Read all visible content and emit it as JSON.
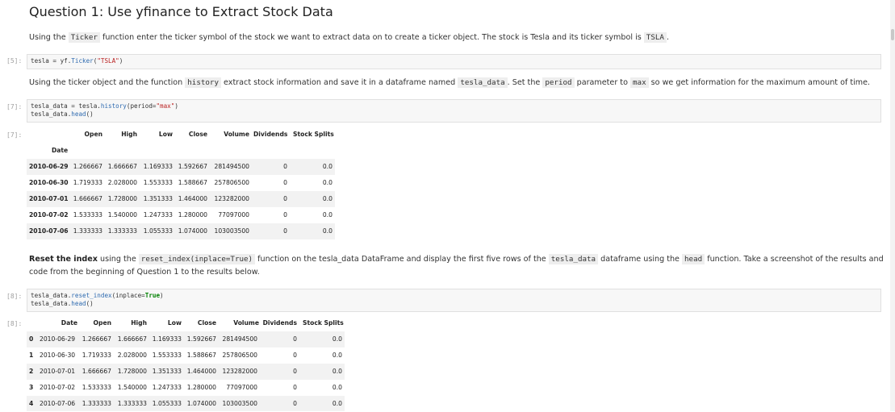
{
  "heading": "Question 1: Use yfinance to Extract Stock Data",
  "md1": {
    "p1": "Using the ",
    "c1": "Ticker",
    "p2": " function enter the ticker symbol of the stock we want to extract data on to create a ticker object. The stock is Tesla and its ticker symbol is ",
    "c2": "TSLA",
    "p3": "."
  },
  "cell5": {
    "prompt": "[5]:",
    "code": {
      "a": "tesla = yf.",
      "b": "Ticker",
      "c": "(",
      "d": "\"TSLA\"",
      "e": ")"
    }
  },
  "md2": {
    "p1": "Using the ticker object and the function ",
    "c1": "history",
    "p2": " extract stock information and save it in a dataframe named ",
    "c2": "tesla_data",
    "p3": ". Set the ",
    "c3": "period",
    "p4": " parameter to ",
    "c4": "max",
    "p5": " so we get information for the maximum amount of time."
  },
  "cell7": {
    "prompt": "[7]:",
    "out_prompt": "[7]:",
    "line1": {
      "a": "tesla_data = tesla.",
      "b": "history",
      "c": "(period=",
      "d": "\"max\"",
      "e": ")"
    },
    "line2": {
      "a": "tesla_data.",
      "b": "head",
      "c": "()"
    }
  },
  "table1": {
    "columns": [
      "Open",
      "High",
      "Low",
      "Close",
      "Volume",
      "Dividends",
      "Stock Splits"
    ],
    "index_name": "Date",
    "rows": [
      [
        "2010-06-29",
        "1.266667",
        "1.666667",
        "1.169333",
        "1.592667",
        "281494500",
        "0",
        "0.0"
      ],
      [
        "2010-06-30",
        "1.719333",
        "2.028000",
        "1.553333",
        "1.588667",
        "257806500",
        "0",
        "0.0"
      ],
      [
        "2010-07-01",
        "1.666667",
        "1.728000",
        "1.351333",
        "1.464000",
        "123282000",
        "0",
        "0.0"
      ],
      [
        "2010-07-02",
        "1.533333",
        "1.540000",
        "1.247333",
        "1.280000",
        "77097000",
        "0",
        "0.0"
      ],
      [
        "2010-07-06",
        "1.333333",
        "1.333333",
        "1.055333",
        "1.074000",
        "103003500",
        "0",
        "0.0"
      ]
    ]
  },
  "md3": {
    "b1": "Reset the index",
    "p1": " using the ",
    "c1": "reset_index(inplace=True)",
    "p2": " function on the tesla_data DataFrame and display the first five rows of the ",
    "c2": "tesla_data",
    "p3": " dataframe using the ",
    "c3": "head",
    "p4": " function. Take a screenshot of the results and",
    "line2": "code from the beginning of Question 1 to the results below."
  },
  "cell8": {
    "prompt": "[8]:",
    "out_prompt": "[8]:",
    "line1": {
      "a": "tesla_data.",
      "b": "reset_index",
      "c": "(inplace=",
      "d": "True",
      "e": ")"
    },
    "line2": {
      "a": "tesla_data.",
      "b": "head",
      "c": "()"
    }
  },
  "table2": {
    "columns": [
      "Date",
      "Open",
      "High",
      "Low",
      "Close",
      "Volume",
      "Dividends",
      "Stock Splits"
    ],
    "rows": [
      [
        "0",
        "2010-06-29",
        "1.266667",
        "1.666667",
        "1.169333",
        "1.592667",
        "281494500",
        "0",
        "0.0"
      ],
      [
        "1",
        "2010-06-30",
        "1.719333",
        "2.028000",
        "1.553333",
        "1.588667",
        "257806500",
        "0",
        "0.0"
      ],
      [
        "2",
        "2010-07-01",
        "1.666667",
        "1.728000",
        "1.351333",
        "1.464000",
        "123282000",
        "0",
        "0.0"
      ],
      [
        "3",
        "2010-07-02",
        "1.533333",
        "1.540000",
        "1.247333",
        "1.280000",
        "77097000",
        "0",
        "0.0"
      ],
      [
        "4",
        "2010-07-06",
        "1.333333",
        "1.333333",
        "1.055333",
        "1.074000",
        "103003500",
        "0",
        "0.0"
      ]
    ]
  }
}
